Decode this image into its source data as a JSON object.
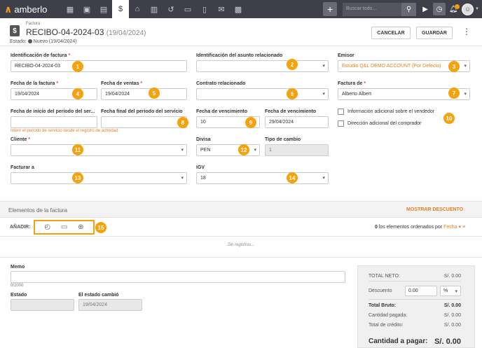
{
  "nav": {
    "brand": "amberlo",
    "search_placeholder": "Buscar todo..."
  },
  "header": {
    "doc_type": "Factura",
    "title": "RECIBO-04-2024-03",
    "title_date": "(19/04/2024)",
    "status_label": "Estado:",
    "status_value": "Nuevo (19/04/2024)",
    "cancel_label": "CANCELAR",
    "save_label": "GUARDAR"
  },
  "form": {
    "invoice_id_label": "Identificación de factura",
    "invoice_id_value": "RECIBO-04-2024-03",
    "matter_label": "Identificación del asunto relacionado",
    "issuer_label": "Emisor",
    "issuer_value": "Estudio Q&L DEMO ACCOUNT (Por Defecto)",
    "invoice_date_label": "Fecha de la factura",
    "invoice_date_value": "19/04/2024",
    "sales_date_label": "Fecha de ventas",
    "sales_date_value": "19/04/2024",
    "contract_label": "Contrato relacionado",
    "invoice_of_label": "Factura de",
    "invoice_of_value": "Alberto Albert",
    "service_start_label": "Fecha de inicio del periodo del ser...",
    "service_end_label": "Fecha final del periodo del servicio",
    "due_label": "Fecha de vencimiento",
    "due_value": "10",
    "due_date_label": "Fecha de vencimiento",
    "due_date_value": "29/04/2024",
    "infer_hint": "Inferir el periodo de servicio desde el registro de actividad",
    "seller_info_label": "Información adicional sobre el vendedor",
    "buyer_address_label": "Dirección adicional del comprador",
    "client_label": "Cliente",
    "currency_label": "Divisa",
    "currency_value": "PEN",
    "exchange_label": "Tipo de cambio",
    "exchange_value": "1",
    "bill_to_label": "Facturar a",
    "tax_label": "IGV",
    "tax_value": "18"
  },
  "badges": [
    "1",
    "2",
    "3",
    "4",
    "5",
    "6",
    "7",
    "8",
    "9",
    "10",
    "11",
    "12",
    "13",
    "14",
    "15"
  ],
  "items": {
    "section_title": "Elementos de la factura",
    "show_discount": "MOSTRAR DESCUENTO",
    "add_label": "AÑADIR:",
    "count": "0",
    "order_text": "los elementos ordenados por",
    "order_field": "Fecha",
    "no_records": "Sin registros..."
  },
  "bottom": {
    "memo_label": "Memo",
    "memo_count": "0/2000",
    "state_label": "Estado",
    "state_changed_label": "El estado cambió",
    "state_changed_value": "19/04/2024"
  },
  "totals": {
    "net_label": "TOTAL NETO:",
    "net_value": "S/. 0.00",
    "discount_label": "Descuento",
    "discount_value": "0.00",
    "discount_unit": "%",
    "gross_label": "Total Bruto:",
    "gross_value": "S/. 0.00",
    "paid_label": "Cantidad pagada:",
    "paid_value": "S/. 0.00",
    "credit_label": "Total de crédito:",
    "credit_value": "S/. 0.00",
    "due_label": "Cantidad a pagar:",
    "due_value": "S/. 0.00"
  },
  "colors": {
    "accent": "#f5a20c",
    "nav_bg": "#3f3f4a",
    "link": "#e67e22"
  }
}
